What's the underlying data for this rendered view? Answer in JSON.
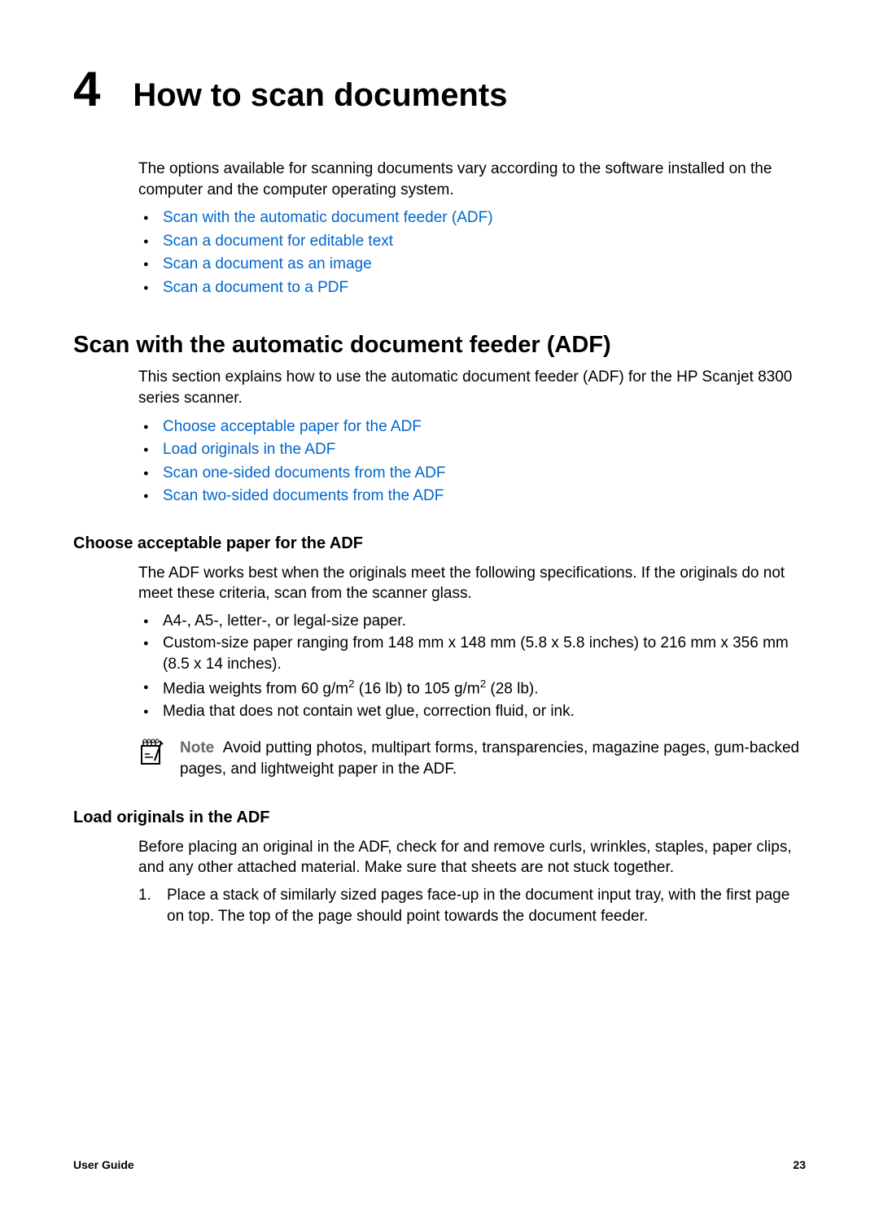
{
  "chapter": {
    "number": "4",
    "title": "How to scan documents"
  },
  "intro": {
    "text": "The options available for scanning documents vary according to the software installed on the computer and the computer operating system.",
    "links": [
      "Scan with the automatic document feeder (ADF)",
      "Scan a document for editable text",
      "Scan a document as an image",
      "Scan a document to a PDF"
    ]
  },
  "section1": {
    "heading": "Scan with the automatic document feeder (ADF)",
    "text": "This section explains how to use the automatic document feeder (ADF) for the HP Scanjet 8300 series scanner.",
    "links": [
      "Choose acceptable paper for the ADF",
      "Load originals in the ADF",
      "Scan one-sided documents from the ADF",
      "Scan two-sided documents from the ADF"
    ]
  },
  "subsection1": {
    "heading": "Choose acceptable paper for the ADF",
    "text": "The ADF works best when the originals meet the following specifications. If the originals do not meet these criteria, scan from the scanner glass.",
    "bullets": {
      "b1": "A4-, A5-, letter-, or legal-size paper.",
      "b2": "Custom-size paper ranging from 148 mm x 148 mm (5.8 x 5.8 inches) to 216 mm x 356 mm (8.5 x 14 inches).",
      "b3_pre": "Media weights from 60 g/m",
      "b3_mid": " (16 lb) to 105 g/m",
      "b3_end": " (28 lb).",
      "b3_sup": "2",
      "b4": "Media that does not contain wet glue, correction fluid, or ink."
    },
    "note_label": "Note",
    "note_text": "Avoid putting photos, multipart forms, transparencies, magazine pages, gum-backed pages, and lightweight paper in the ADF."
  },
  "subsection2": {
    "heading": "Load originals in the ADF",
    "text": "Before placing an original in the ADF, check for and remove curls, wrinkles, staples, paper clips, and any other attached material. Make sure that sheets are not stuck together.",
    "step1_num": "1.",
    "step1": "Place a stack of similarly sized pages face-up in the document input tray, with the first page on top. The top of the page should point towards the document feeder."
  },
  "footer": {
    "left": "User Guide",
    "right": "23"
  }
}
